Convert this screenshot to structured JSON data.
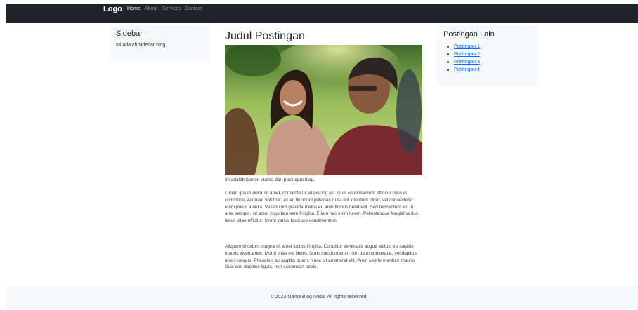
{
  "navbar": {
    "brand": "Logo",
    "links": [
      "Home",
      "About",
      "Services",
      "Contact"
    ],
    "active": "Home"
  },
  "sidebar": {
    "title": "Sidebar",
    "text": "Ini adalah sidebar blog."
  },
  "post": {
    "title": "Judul Postingan",
    "caption": "Ini adalah konten utama dari postingan blog.",
    "paragraphs": [
      "Lorem ipsum dolor sit amet, consectetur adipiscing elit. Duis condimentum efficitur risus in commodo. Aliquam volutpat, ex ac tincidunt pulvinar, nulla elit interdum tortor, vel consectetur enim purus a nulla. Vestibulum gravida metus eu arcu finibus hendrerit. Sed fermentum leo in ante semper, sit amet vulputate sem fringilla. Etiam nec enim lorem. Pellentesque feugiat varius lacus vitae efficitur. Morbi varius faucibus condimentum.",
      "Aliquam tincidunt magna sit amet luctus fringilla. Curabitur venenatis augue lectus, eu sagittis mauris viverra nec. Morbi vitae est libero. Nunc tincidunt enim non diam consequat, vel dapibus dolor congue. Phasellus ac sagittis quam. Nunc sit amet erat elit. Proin sed fermentum mauris. Duis sed dapibus ligula, non accumsan turpis."
    ]
  },
  "other_posts": {
    "title": "Postingan Lain",
    "links": [
      "Postingan 1",
      "Postingan 2",
      "Postingan 3",
      "Postingan 4"
    ]
  },
  "footer": {
    "text": "© 2023 Nama Blog Anda. All rights reserved."
  },
  "colors": {
    "navbar_bg": "#212529",
    "panel_bg": "#f8f9fa",
    "link": "#0d6efd"
  }
}
